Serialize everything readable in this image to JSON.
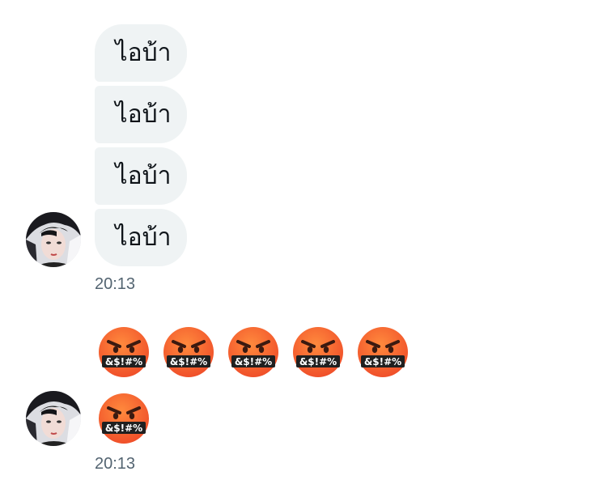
{
  "conversation": {
    "group1": {
      "messages": [
        "ไอบ้า",
        "ไอบ้า",
        "ไอบ้า",
        "ไอบ้า"
      ],
      "timestamp": "20:13"
    },
    "group2": {
      "emoji_row1_count": 5,
      "emoji_row2_count": 1,
      "emoji_name": "face-with-symbols-on-mouth",
      "emoji_symbols": "&$!#%",
      "timestamp": "20:13"
    }
  },
  "colors": {
    "bubble_bg": "#eff3f4",
    "text": "#0f1419",
    "timestamp": "#536471",
    "emoji_face": "#f0502a"
  },
  "icons": {
    "avatar": "avatar-photo",
    "emoji": "face-with-symbols-on-mouth-icon"
  }
}
